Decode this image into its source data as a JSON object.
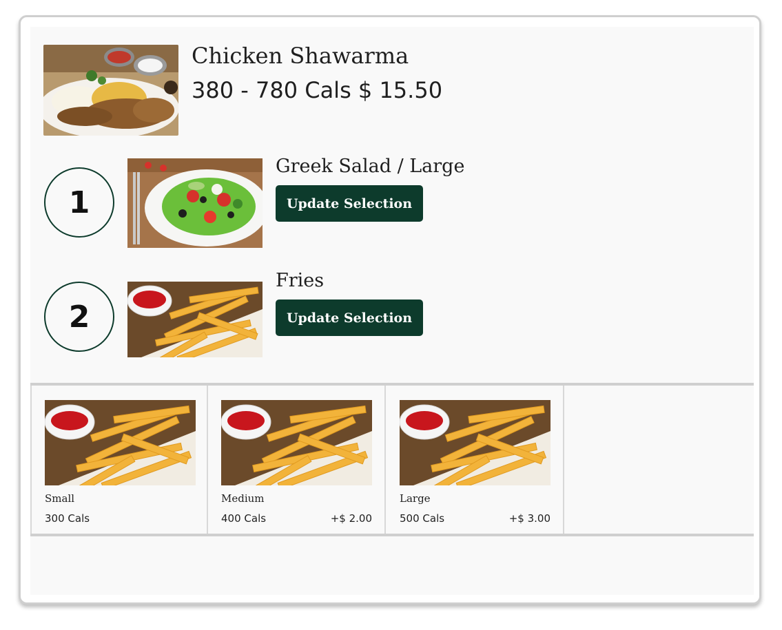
{
  "item": {
    "title": "Chicken Shawarma",
    "subtitle": "380 - 780 Cals $ 15.50"
  },
  "selections": [
    {
      "number": "1",
      "name": "Greek Salad / Large",
      "button_label": "Update Selection",
      "image": "greek-salad"
    },
    {
      "number": "2",
      "name": "Fries",
      "button_label": "Update Selection",
      "image": "fries"
    }
  ],
  "options": [
    {
      "name": "Small",
      "cals": "300 Cals",
      "price": ""
    },
    {
      "name": "Medium",
      "cals": "400 Cals",
      "price": "+$ 2.00"
    },
    {
      "name": "Large",
      "cals": "500 Cals",
      "price": "+$ 3.00"
    }
  ],
  "colors": {
    "accent": "#0d3b2c",
    "panel": "#f9f9f9",
    "border": "#cfcfcf"
  }
}
